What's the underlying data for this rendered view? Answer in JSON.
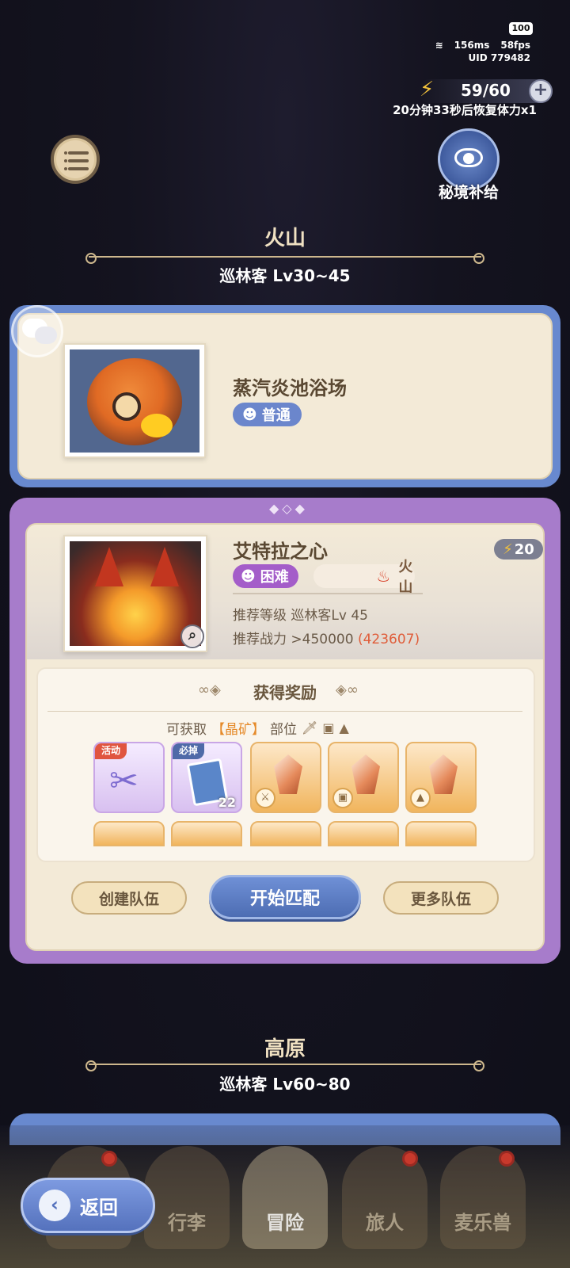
{
  "status": {
    "battery": "100",
    "ping": "156ms",
    "fps": "58fps",
    "uid": "UID 779482"
  },
  "stamina": {
    "value": "59/60",
    "recover_text": "20分钟33秒后恢复体力x1"
  },
  "supply": {
    "label": "秘境补给"
  },
  "sections": [
    {
      "title": "火山",
      "subtitle": "巡林客  Lv30~45"
    },
    {
      "title": "高原",
      "subtitle": "巡林客  Lv60~80"
    }
  ],
  "dungeon_normal": {
    "name": "蒸汽炎池浴场",
    "difficulty": "普通"
  },
  "dungeon_hard": {
    "name": "艾特拉之心",
    "cost": "20",
    "difficulty": "困难",
    "element": "火山",
    "rec_level": "推荐等级 巡林客Lv  45",
    "rec_power_label": "推荐战力  >450000",
    "my_power": "(423607)"
  },
  "rewards": {
    "title": "获得奖励",
    "obtain_prefix": "可获取",
    "obtain_highlight": "【晶矿】",
    "obtain_suffix": "部位",
    "items": [
      {
        "flag": "活动",
        "flag_color": "red",
        "style": "purple",
        "icon": "scissors-icon"
      },
      {
        "flag": "必掉",
        "flag_color": "blue",
        "style": "purple",
        "icon": "ticket-icon",
        "count": "22"
      },
      {
        "style": "orange",
        "icon": "crystal-icon",
        "part": "sword"
      },
      {
        "style": "orange",
        "icon": "crystal-icon",
        "part": "armor"
      },
      {
        "style": "orange",
        "icon": "crystal-icon",
        "part": "boots"
      }
    ]
  },
  "buttons": {
    "create_team": "创建队伍",
    "start_match": "开始匹配",
    "more_teams": "更多队伍",
    "back": "返回"
  },
  "nav": {
    "tabs": [
      "行李",
      "冒险",
      "旅人",
      "麦乐兽"
    ],
    "active": "冒险"
  },
  "colors": {
    "normal_frame": "#6889cf",
    "hard_frame": "#a77ccb",
    "highlight": "#e05d3a"
  }
}
